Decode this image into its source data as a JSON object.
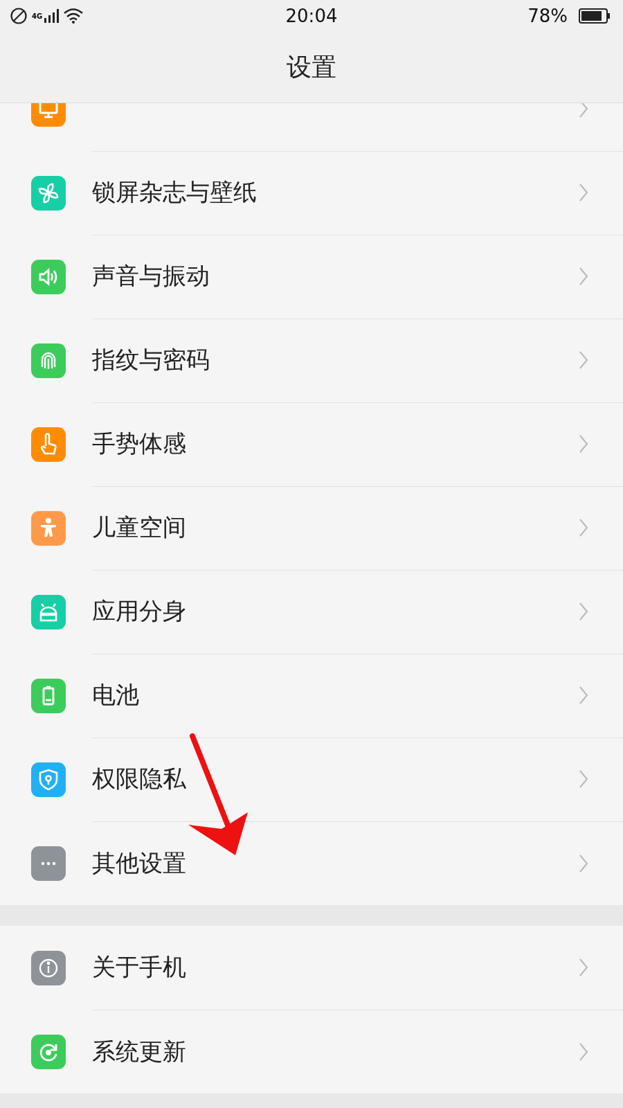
{
  "status_bar": {
    "network": "4G",
    "time": "20:04",
    "battery": "78%"
  },
  "title": "设置",
  "groups": [
    {
      "items": [
        {
          "kind": "display"
        },
        {
          "label": "锁屏杂志与壁纸",
          "kind": "wallpaper"
        },
        {
          "label": "声音与振动",
          "kind": "sound"
        },
        {
          "label": "指纹与密码",
          "kind": "fingerprint"
        },
        {
          "label": "手势体感",
          "kind": "gesture"
        },
        {
          "label": "儿童空间",
          "kind": "kids"
        },
        {
          "label": "应用分身",
          "kind": "clone"
        },
        {
          "label": "电池",
          "kind": "battery"
        },
        {
          "label": "权限隐私",
          "kind": "privacy"
        },
        {
          "label": "其他设置",
          "kind": "more"
        }
      ]
    },
    {
      "items": [
        {
          "label": "关于手机",
          "kind": "about"
        },
        {
          "label": "系统更新",
          "kind": "update"
        }
      ]
    }
  ]
}
